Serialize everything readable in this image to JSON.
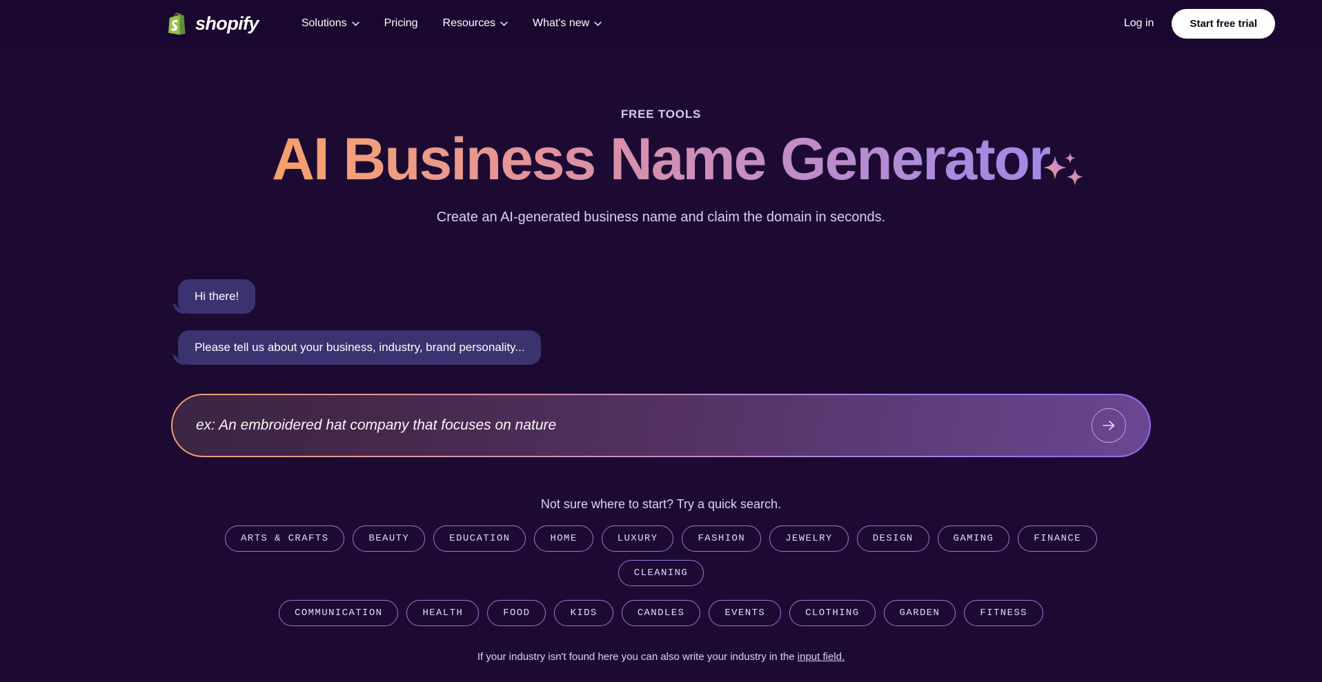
{
  "header": {
    "logo_word": "shopify",
    "logo_icon": "shopify-bag-icon",
    "nav": [
      {
        "label": "Solutions",
        "has_chevron": true
      },
      {
        "label": "Pricing",
        "has_chevron": false
      },
      {
        "label": "Resources",
        "has_chevron": true
      },
      {
        "label": "What's new",
        "has_chevron": true
      }
    ],
    "login_label": "Log in",
    "cta_label": "Start free trial"
  },
  "hero": {
    "eyebrow": "FREE TOOLS",
    "headline": "AI Business Name Generator",
    "subtitle": "Create an AI-generated business name and claim the domain in seconds.",
    "sparkle_icon": "sparkles-icon"
  },
  "chat": {
    "messages": [
      "Hi there!",
      "Please tell us about your business, industry, brand personality..."
    ]
  },
  "prompt": {
    "value": "",
    "placeholder": "ex: An embroidered hat company that focuses on nature",
    "submit_icon": "arrow-right-icon"
  },
  "quick_search": {
    "label": "Not sure where to start? Try a quick search.",
    "chips_row1": [
      "ARTS & CRAFTS",
      "BEAUTY",
      "EDUCATION",
      "HOME",
      "LUXURY",
      "FASHION",
      "JEWELRY",
      "DESIGN",
      "GAMING",
      "FINANCE",
      "CLEANING"
    ],
    "chips_row2": [
      "COMMUNICATION",
      "HEALTH",
      "FOOD",
      "KIDS",
      "CANDLES",
      "EVENTS",
      "CLOTHING",
      "GARDEN",
      "FITNESS"
    ]
  },
  "footnote": {
    "text_before": "If your industry isn't found here you can also write your industry in the ",
    "link_label": "input field."
  },
  "colors": {
    "page_bg": "#1c0a33",
    "header_bg": "#190730",
    "bubble_bg": "#3b3270",
    "chip_border": "#9a7ad6",
    "accent_orange": "#f0a070",
    "accent_purple": "#9a7bf0",
    "shopify_green": "#7cb342"
  }
}
